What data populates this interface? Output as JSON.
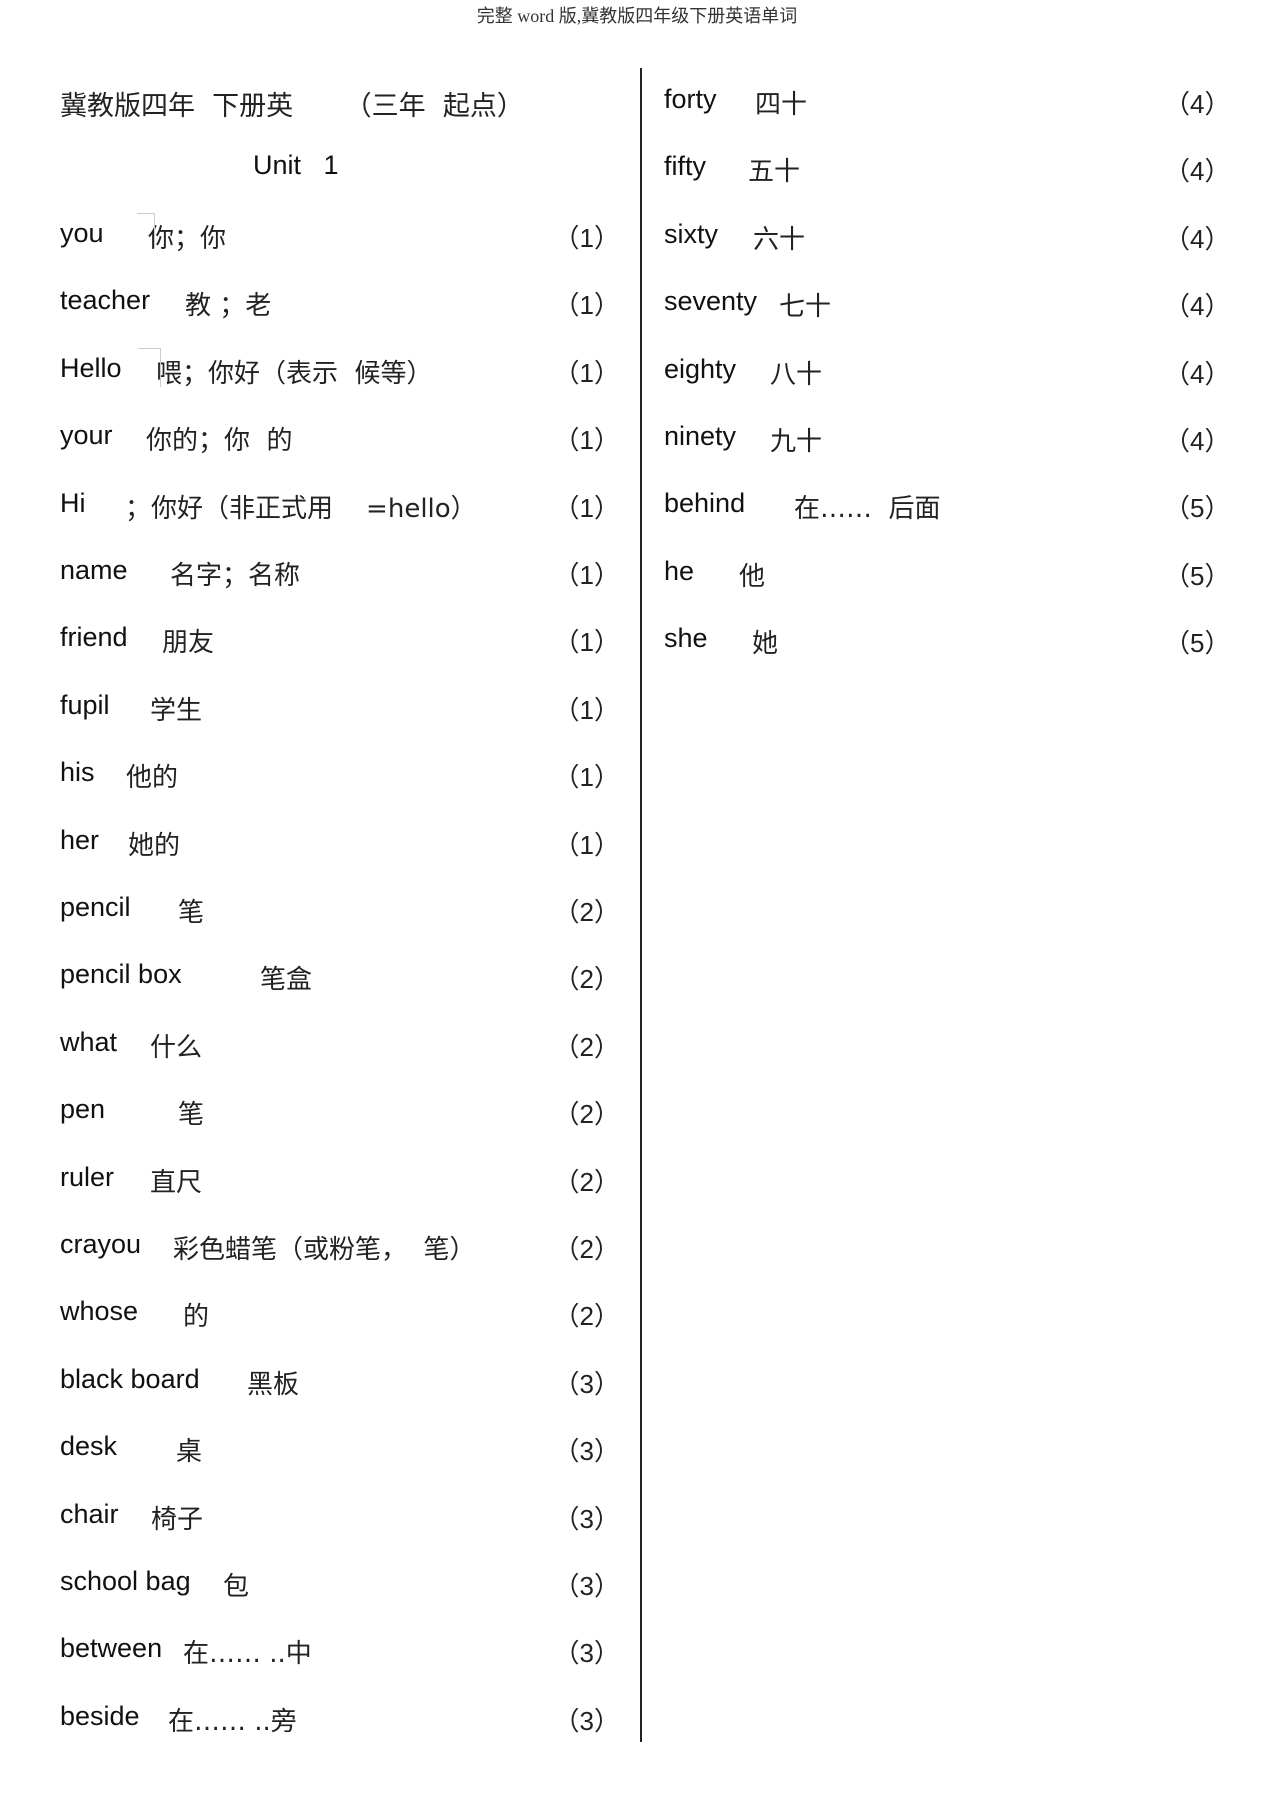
{
  "header": "完整 word 版,冀教版四年级下册英语单词",
  "title": "冀教版四年  下册英      （三年  起点）",
  "unit": "Unit   1",
  "left_rows": [
    {
      "en": "you",
      "zh": "你；你",
      "num": "（1）"
    },
    {
      "en": "teacher",
      "zh": "教 ；老",
      "num": "（1）"
    },
    {
      "en": "Hello",
      "zh": "喂；你好（表示  候等）",
      "num": "（1）"
    },
    {
      "en": "your",
      "zh": "你的；你  的",
      "num": "（1）"
    },
    {
      "en": "Hi",
      "zh": "；你好（非正式用    =hello）",
      "num": "（1）"
    },
    {
      "en": "name",
      "zh": "名字；名称",
      "num": "（1）"
    },
    {
      "en": "friend",
      "zh": "朋友",
      "num": "（1）"
    },
    {
      "en": "fupil",
      "zh": "学生",
      "num": "（1）"
    },
    {
      "en": "his",
      "zh": "他的",
      "num": "（1）"
    },
    {
      "en": "her",
      "zh": "她的",
      "num": "（1）"
    },
    {
      "en": "pencil",
      "zh": "笔",
      "num": "（2）"
    },
    {
      "en": "pencil box",
      "zh": "笔盒",
      "num": "（2）"
    },
    {
      "en": "what",
      "zh": "什么",
      "num": "（2）"
    },
    {
      "en": "pen",
      "zh": "笔",
      "num": "（2）"
    },
    {
      "en": "ruler",
      "zh": "直尺",
      "num": "（2）"
    },
    {
      "en": "crayou",
      "zh": "彩色蜡笔（或粉笔，  笔）",
      "num": "（2）"
    },
    {
      "en": "whose",
      "zh": "的",
      "num": "（2）"
    },
    {
      "en": "black board",
      "zh": "黑板",
      "num": "（3）"
    },
    {
      "en": "desk",
      "zh": "桌",
      "num": "（3）"
    },
    {
      "en": "chair",
      "zh": "椅子",
      "num": "（3）"
    },
    {
      "en": "school bag",
      "zh": "包",
      "num": "（3）"
    },
    {
      "en": "between",
      "zh": "在…… ..中",
      "num": "（3）"
    },
    {
      "en": "beside",
      "zh": "在…… ..旁",
      "num": "（3）"
    }
  ],
  "right_rows": [
    {
      "en": "forty",
      "zh": "四十",
      "num": "（4）"
    },
    {
      "en": "fifty",
      "zh": "五十",
      "num": "（4）"
    },
    {
      "en": "sixty",
      "zh": "六十",
      "num": "（4）"
    },
    {
      "en": "seventy",
      "zh": "七十",
      "num": "（4）"
    },
    {
      "en": "eighty",
      "zh": "八十",
      "num": "（4）"
    },
    {
      "en": "ninety",
      "zh": "九十",
      "num": "（4）"
    },
    {
      "en": "behind",
      "zh": "在……  后面",
      "num": "（5）"
    },
    {
      "en": "he",
      "zh": "他",
      "num": "（5）"
    },
    {
      "en": "she",
      "zh": "她",
      "num": "（5）"
    }
  ]
}
